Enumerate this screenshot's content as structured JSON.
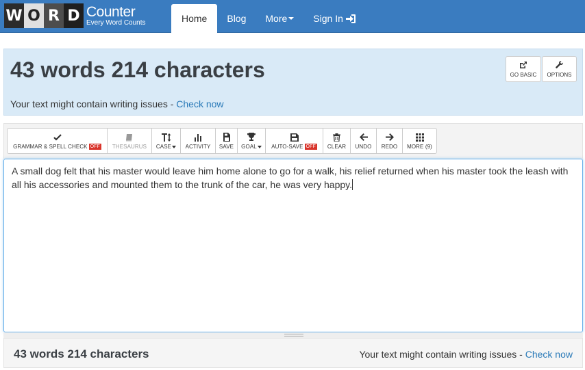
{
  "logo": {
    "letters": [
      "W",
      "O",
      "R",
      "D"
    ],
    "main": "Counter",
    "sub": "Every Word Counts"
  },
  "nav": {
    "home": "Home",
    "blog": "Blog",
    "more": "More",
    "signin": "Sign In"
  },
  "headline": "43 words 214 characters",
  "issues": {
    "text": "Your text might contain writing issues - ",
    "link": "Check now"
  },
  "top_buttons": {
    "go_basic": "GO BASIC",
    "options": "OPTIONS"
  },
  "toolbar": {
    "grammar": "GRAMMAR & SPELL CHECK",
    "grammar_state": "OFF",
    "thesaurus": "THESAURUS",
    "case": "CASE",
    "activity": "ACTIVITY",
    "save": "SAVE",
    "goal": "GOAL",
    "autosave": "AUTO-SAVE",
    "autosave_state": "OFF",
    "clear": "CLEAR",
    "undo": "UNDO",
    "redo": "REDO",
    "more": "MORE (9)"
  },
  "editor": {
    "text": "A small dog felt that his master would leave him home alone to go for a walk, his relief returned when his master took the leash with all his accessories and mounted them to the trunk of the car, he was very happy."
  },
  "bottom": {
    "count": "43 words 214 characters",
    "issues_text": "Your text might contain writing issues - ",
    "issues_link": "Check now"
  },
  "colors": {
    "nav_bg": "#3a7cc0",
    "panel_bg": "#d9eaf7",
    "link": "#2a7ab8",
    "off_badge": "#d9342b"
  }
}
